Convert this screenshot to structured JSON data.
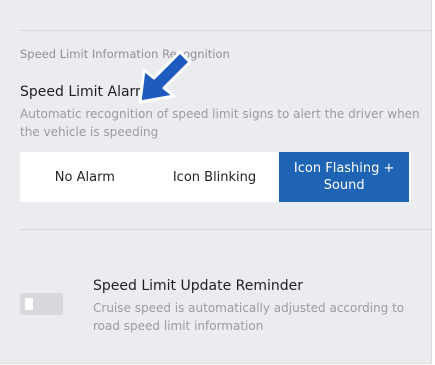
{
  "section": {
    "title": "Speed Limit Information Recognition"
  },
  "speed_limit_alarm": {
    "title": "Speed Limit Alarm",
    "description": "Automatic recognition of speed limit signs to alert the driver when the vehicle is speeding",
    "options": [
      "No Alarm",
      "Icon Blinking",
      "Icon Flashing + Sound"
    ],
    "selected": "Icon Flashing + Sound"
  },
  "update_reminder": {
    "title": "Speed Limit Update Reminder",
    "description": "Cruise speed is automatically adjusted according to road speed limit information",
    "enabled": false
  },
  "colors": {
    "panel_background": "#ebecf0",
    "accent": "#1f63b5",
    "annotation_arrow": "#1f5bbf"
  },
  "annotation": {
    "icon": "arrow-icon"
  }
}
